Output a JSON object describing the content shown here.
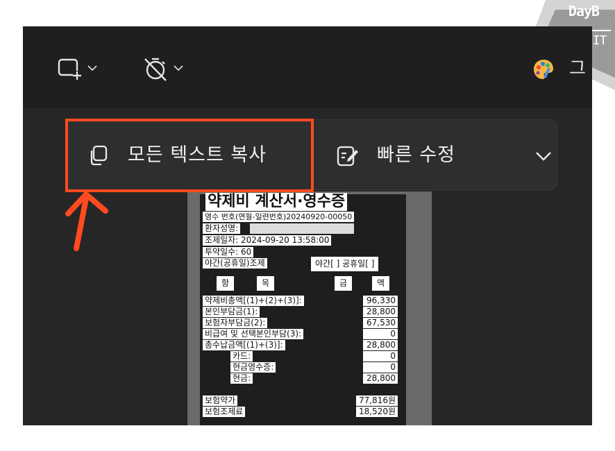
{
  "watermark": {
    "brand": "DayB",
    "tagline": "IT'S IT"
  },
  "toolbar": {
    "capture_mode_icon": "rectangle-snip-icon",
    "timer_icon": "timer-off-icon",
    "chevron_icon": "chevron-down-icon",
    "right_app_icon": "paint-palette-icon",
    "right_app_label": "그"
  },
  "actions": {
    "copy_all_text": {
      "icon": "copy-icon",
      "label": "모든 텍스트 복사"
    },
    "quick_edit": {
      "icon": "edit-note-icon",
      "label": "빠른 수정"
    },
    "more_icon": "chevron-down-icon"
  },
  "annotation": {
    "highlight_color": "#ff4b1f"
  },
  "receipt": {
    "title": "약제비 계산서·영수증",
    "issue_no": "영수 번호(연월-일련번호)20240920-00050",
    "patient_label": "환자성명:",
    "dispense_date": "조제일자: 2024-09-20 13:58:00",
    "days": "투약일수: 60",
    "night": "야간(공휴일)조제",
    "night_flags": "야간[ ] 공휴일[ ]",
    "headers": [
      "항",
      "목",
      "금",
      "액"
    ],
    "rows": [
      {
        "label": "약제비총액[(1)+(2)+(3)]:",
        "value": "96,330"
      },
      {
        "label": "본인부담금(1):",
        "value": "28,800"
      },
      {
        "label": "보험자부담금(2):",
        "value": "67,530"
      },
      {
        "label": "비급여 및 선택본인부담(3):",
        "value": "0"
      },
      {
        "label": "총수납금액[(1)+(3)]:",
        "value": "28,800"
      },
      {
        "label": "카드:",
        "value": "0"
      },
      {
        "label": "현금영수증:",
        "value": "0"
      },
      {
        "label": "현금:",
        "value": "28,800"
      }
    ],
    "footer": [
      {
        "label": "보험약가",
        "value": "77,816원"
      },
      {
        "label": "보험조제료",
        "value": "18,520원"
      }
    ]
  }
}
